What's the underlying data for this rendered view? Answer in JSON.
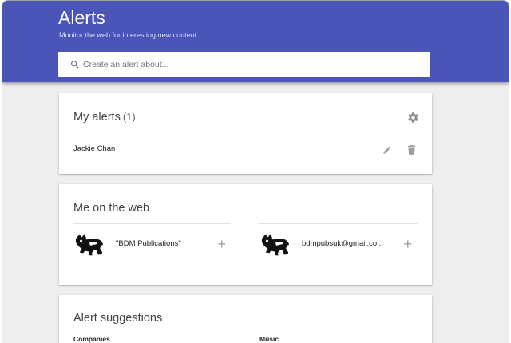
{
  "header": {
    "title": "Alerts",
    "subtitle": "Monitor the web for interesting new content",
    "search_placeholder": "Create an alert about..."
  },
  "my_alerts": {
    "title": "My alerts",
    "count": "(1)",
    "items": [
      {
        "label": "Jackie Chan"
      }
    ]
  },
  "me_on_web": {
    "title": "Me on the web",
    "items": [
      {
        "label": "\"BDM Publications\""
      },
      {
        "label": "bdmpubsuk@gmail.co..."
      }
    ]
  },
  "suggestions": {
    "title": "Alert suggestions",
    "columns": [
      "Companies",
      "Music"
    ]
  },
  "icons": {
    "search": "search-icon",
    "settings": "gear-icon",
    "edit": "pencil-icon",
    "delete": "trash-icon",
    "add": "plus-icon",
    "avatar": "dog-avatar-icon"
  },
  "colors": {
    "header": "#4a55b7",
    "background": "#eeeeee",
    "card": "#ffffff",
    "icon": "#9e9e9e"
  }
}
